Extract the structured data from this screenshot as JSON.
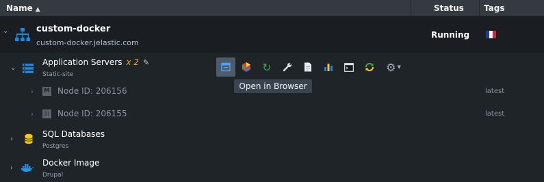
{
  "header": {
    "name_label": "Name",
    "sort_icon": "▲",
    "status_label": "Status",
    "tags_label": "Tags"
  },
  "environment": {
    "name": "custom-docker",
    "url": "custom-docker.jelastic.com",
    "status": "Running",
    "icon": "environment-topology-icon",
    "tag_icon": "france-flag-icon",
    "status_color": "#ffffff"
  },
  "groups": [
    {
      "title": "Application Servers",
      "count": "x 2",
      "subtitle": "Static-site",
      "icon": "app-server-icon",
      "nodes": [
        {
          "label": "Node ID: 206156",
          "tag": "latest",
          "badge": "M"
        },
        {
          "label": "Node ID: 206155",
          "tag": "latest",
          "badge": "|||"
        }
      ]
    },
    {
      "title": "SQL Databases",
      "subtitle": "Postgres",
      "icon": "database-icon"
    },
    {
      "title": "Docker Image",
      "subtitle": "Drupal",
      "icon": "docker-icon"
    }
  ],
  "toolbar": {
    "tooltip": "Open in Browser",
    "buttons": [
      "open-in-browser-icon",
      "add-ons-icon",
      "restart-icon",
      "config-icon",
      "log-icon",
      "statistics-icon",
      "web-ssh-icon",
      "redeploy-icon",
      "settings-icon"
    ]
  },
  "colors": {
    "accent_blue": "#1e88e5",
    "count_orange": "#f5a623",
    "running": "#ffffff"
  }
}
